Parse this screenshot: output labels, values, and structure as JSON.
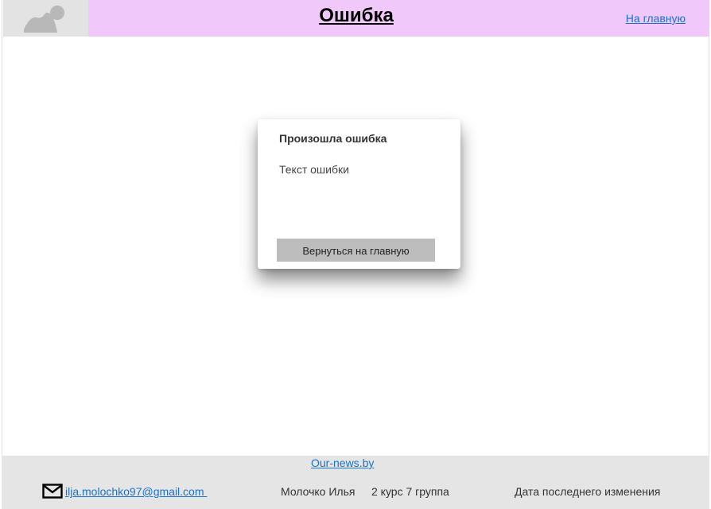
{
  "header": {
    "title": "Ошибка",
    "home_link": "На главную",
    "logo_icon": "image-placeholder-icon"
  },
  "dialog": {
    "title": "Произошла ошибка",
    "message": "Текст ошибки",
    "button_label": "Вернуться на главную"
  },
  "footer": {
    "site_link": "Our-news.by",
    "email": "ilja.molochko97@gmail.com ",
    "email_icon": "envelope-icon",
    "author": "Молочко Илья",
    "group": "2 курс 7 группа",
    "last_updated_label": "Дата последнего изменения"
  },
  "colors": {
    "header_bg": "#f0c9fa",
    "logo_bg": "#e3e3e3",
    "footer_bg": "#e5e5e5",
    "link": "#1a73c9",
    "button_bg": "#bdbdbd"
  }
}
